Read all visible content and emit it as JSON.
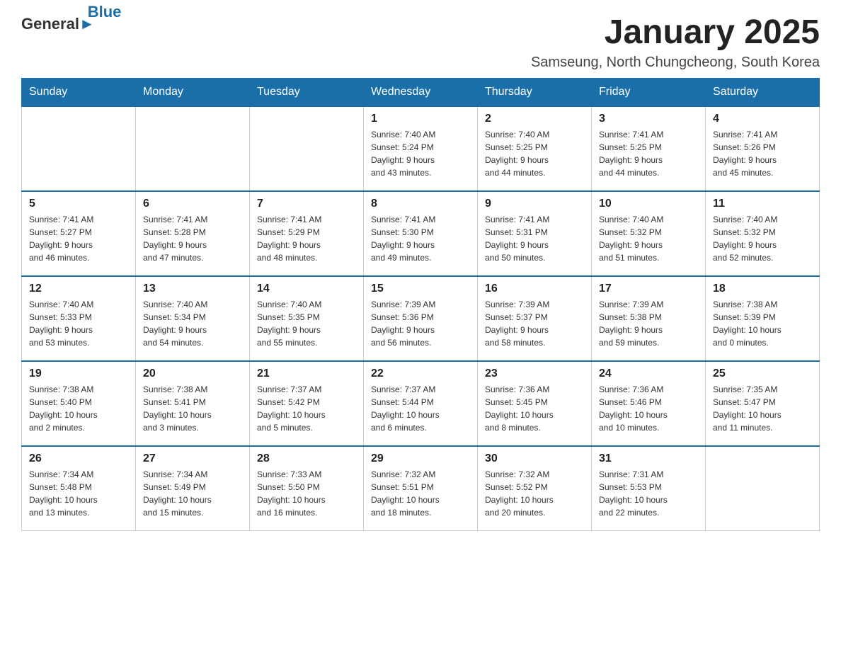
{
  "header": {
    "logo_general": "General",
    "logo_blue": "Blue",
    "month_title": "January 2025",
    "location": "Samseung, North Chungcheong, South Korea"
  },
  "days_of_week": [
    "Sunday",
    "Monday",
    "Tuesday",
    "Wednesday",
    "Thursday",
    "Friday",
    "Saturday"
  ],
  "weeks": [
    [
      {
        "day": "",
        "info": ""
      },
      {
        "day": "",
        "info": ""
      },
      {
        "day": "",
        "info": ""
      },
      {
        "day": "1",
        "info": "Sunrise: 7:40 AM\nSunset: 5:24 PM\nDaylight: 9 hours\nand 43 minutes."
      },
      {
        "day": "2",
        "info": "Sunrise: 7:40 AM\nSunset: 5:25 PM\nDaylight: 9 hours\nand 44 minutes."
      },
      {
        "day": "3",
        "info": "Sunrise: 7:41 AM\nSunset: 5:25 PM\nDaylight: 9 hours\nand 44 minutes."
      },
      {
        "day": "4",
        "info": "Sunrise: 7:41 AM\nSunset: 5:26 PM\nDaylight: 9 hours\nand 45 minutes."
      }
    ],
    [
      {
        "day": "5",
        "info": "Sunrise: 7:41 AM\nSunset: 5:27 PM\nDaylight: 9 hours\nand 46 minutes."
      },
      {
        "day": "6",
        "info": "Sunrise: 7:41 AM\nSunset: 5:28 PM\nDaylight: 9 hours\nand 47 minutes."
      },
      {
        "day": "7",
        "info": "Sunrise: 7:41 AM\nSunset: 5:29 PM\nDaylight: 9 hours\nand 48 minutes."
      },
      {
        "day": "8",
        "info": "Sunrise: 7:41 AM\nSunset: 5:30 PM\nDaylight: 9 hours\nand 49 minutes."
      },
      {
        "day": "9",
        "info": "Sunrise: 7:41 AM\nSunset: 5:31 PM\nDaylight: 9 hours\nand 50 minutes."
      },
      {
        "day": "10",
        "info": "Sunrise: 7:40 AM\nSunset: 5:32 PM\nDaylight: 9 hours\nand 51 minutes."
      },
      {
        "day": "11",
        "info": "Sunrise: 7:40 AM\nSunset: 5:32 PM\nDaylight: 9 hours\nand 52 minutes."
      }
    ],
    [
      {
        "day": "12",
        "info": "Sunrise: 7:40 AM\nSunset: 5:33 PM\nDaylight: 9 hours\nand 53 minutes."
      },
      {
        "day": "13",
        "info": "Sunrise: 7:40 AM\nSunset: 5:34 PM\nDaylight: 9 hours\nand 54 minutes."
      },
      {
        "day": "14",
        "info": "Sunrise: 7:40 AM\nSunset: 5:35 PM\nDaylight: 9 hours\nand 55 minutes."
      },
      {
        "day": "15",
        "info": "Sunrise: 7:39 AM\nSunset: 5:36 PM\nDaylight: 9 hours\nand 56 minutes."
      },
      {
        "day": "16",
        "info": "Sunrise: 7:39 AM\nSunset: 5:37 PM\nDaylight: 9 hours\nand 58 minutes."
      },
      {
        "day": "17",
        "info": "Sunrise: 7:39 AM\nSunset: 5:38 PM\nDaylight: 9 hours\nand 59 minutes."
      },
      {
        "day": "18",
        "info": "Sunrise: 7:38 AM\nSunset: 5:39 PM\nDaylight: 10 hours\nand 0 minutes."
      }
    ],
    [
      {
        "day": "19",
        "info": "Sunrise: 7:38 AM\nSunset: 5:40 PM\nDaylight: 10 hours\nand 2 minutes."
      },
      {
        "day": "20",
        "info": "Sunrise: 7:38 AM\nSunset: 5:41 PM\nDaylight: 10 hours\nand 3 minutes."
      },
      {
        "day": "21",
        "info": "Sunrise: 7:37 AM\nSunset: 5:42 PM\nDaylight: 10 hours\nand 5 minutes."
      },
      {
        "day": "22",
        "info": "Sunrise: 7:37 AM\nSunset: 5:44 PM\nDaylight: 10 hours\nand 6 minutes."
      },
      {
        "day": "23",
        "info": "Sunrise: 7:36 AM\nSunset: 5:45 PM\nDaylight: 10 hours\nand 8 minutes."
      },
      {
        "day": "24",
        "info": "Sunrise: 7:36 AM\nSunset: 5:46 PM\nDaylight: 10 hours\nand 10 minutes."
      },
      {
        "day": "25",
        "info": "Sunrise: 7:35 AM\nSunset: 5:47 PM\nDaylight: 10 hours\nand 11 minutes."
      }
    ],
    [
      {
        "day": "26",
        "info": "Sunrise: 7:34 AM\nSunset: 5:48 PM\nDaylight: 10 hours\nand 13 minutes."
      },
      {
        "day": "27",
        "info": "Sunrise: 7:34 AM\nSunset: 5:49 PM\nDaylight: 10 hours\nand 15 minutes."
      },
      {
        "day": "28",
        "info": "Sunrise: 7:33 AM\nSunset: 5:50 PM\nDaylight: 10 hours\nand 16 minutes."
      },
      {
        "day": "29",
        "info": "Sunrise: 7:32 AM\nSunset: 5:51 PM\nDaylight: 10 hours\nand 18 minutes."
      },
      {
        "day": "30",
        "info": "Sunrise: 7:32 AM\nSunset: 5:52 PM\nDaylight: 10 hours\nand 20 minutes."
      },
      {
        "day": "31",
        "info": "Sunrise: 7:31 AM\nSunset: 5:53 PM\nDaylight: 10 hours\nand 22 minutes."
      },
      {
        "day": "",
        "info": ""
      }
    ]
  ]
}
